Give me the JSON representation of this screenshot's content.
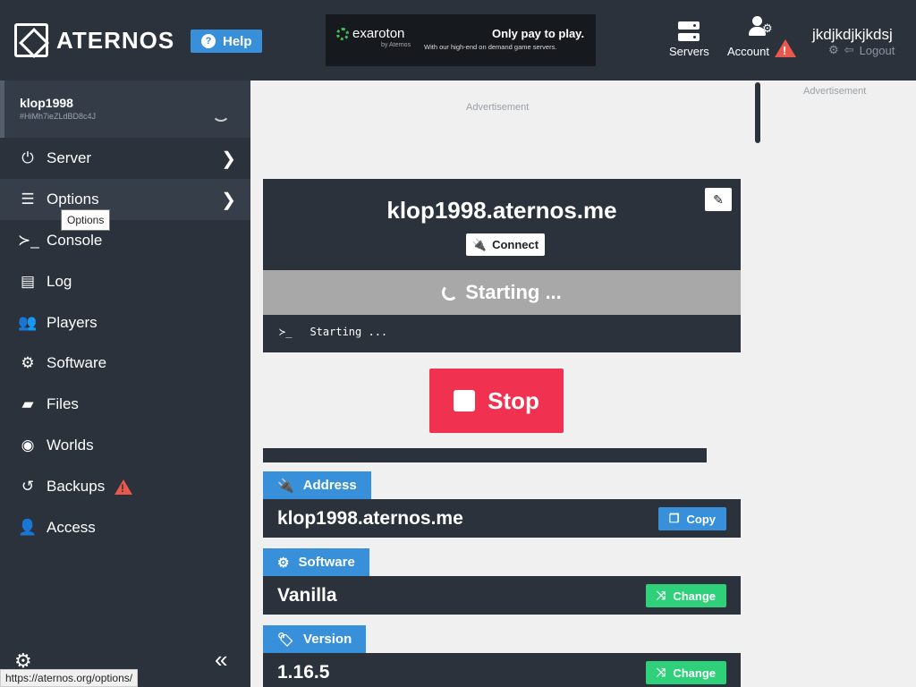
{
  "header": {
    "logo": "ATERNOS",
    "help_label": "Help",
    "ad": {
      "brand": "exaroton",
      "brand_sub": "by Aternos",
      "headline": "Only pay to play.",
      "sub": "With our high-end on demand game servers."
    },
    "servers_label": "Servers",
    "account_label": "Account",
    "username": "jkdjkdjkjkdsj",
    "logout_label": "Logout"
  },
  "sidebar": {
    "server_name": "klop1998",
    "server_id": "#HiMh7ieZLdBD8c4J",
    "items": [
      {
        "label": "Server",
        "icon": "power-icon"
      },
      {
        "label": "Options",
        "icon": "sliders-icon"
      },
      {
        "label": "Console",
        "icon": "terminal-icon"
      },
      {
        "label": "Log",
        "icon": "file-icon"
      },
      {
        "label": "Players",
        "icon": "users-icon"
      },
      {
        "label": "Software",
        "icon": "gears-icon"
      },
      {
        "label": "Files",
        "icon": "folder-icon"
      },
      {
        "label": "Worlds",
        "icon": "globe-icon"
      },
      {
        "label": "Backups",
        "icon": "history-icon"
      },
      {
        "label": "Access",
        "icon": "user-lock-icon"
      }
    ],
    "tooltip": "Options"
  },
  "status_url": "https://aternos.org/options/",
  "ads": {
    "label": "Advertisement"
  },
  "status": {
    "domain": "klop1998.aternos.me",
    "connect_label": "Connect",
    "state": "Starting ...",
    "console_line": "Starting ..."
  },
  "stop_label": "Stop",
  "info": {
    "address": {
      "label": "Address",
      "value": "klop1998.aternos.me",
      "button": "Copy"
    },
    "software": {
      "label": "Software",
      "value": "Vanilla",
      "button": "Change"
    },
    "version": {
      "label": "Version",
      "value": "1.16.5",
      "button": "Change"
    }
  },
  "colors": {
    "dark": "#2b323c",
    "accent_blue": "#3790d9",
    "stop_red": "#f0314f",
    "change_green": "#2fd07a",
    "warning": "#e8584d"
  }
}
